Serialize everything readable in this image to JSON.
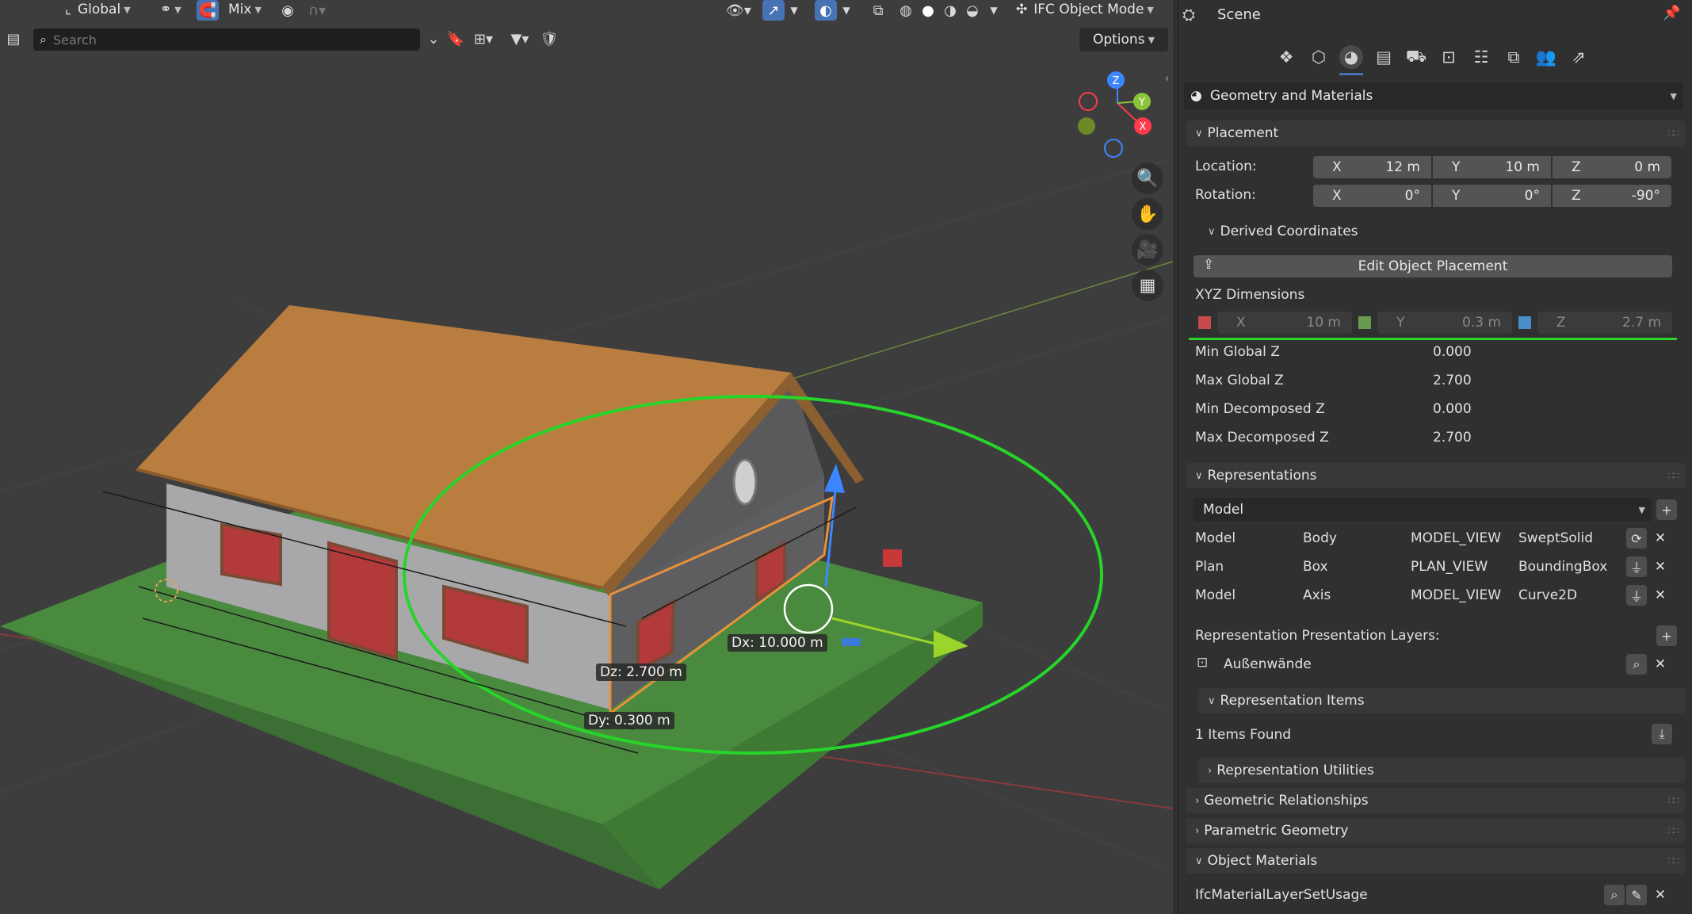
{
  "header": {
    "orientation": "Global",
    "snap_mode": "Mix",
    "mode": "IFC Object Mode",
    "search_placeholder": "Search",
    "options_label": "Options"
  },
  "viewport": {
    "gizmo_axes": [
      "Z",
      "Y",
      "X"
    ],
    "measure": {
      "dx": "Dx: 10.000 m",
      "dy": "Dy: 0.300 m",
      "dz": "Dz: 2.700 m"
    }
  },
  "panel": {
    "title": "Scene",
    "tab_icons": [
      "scene-icon",
      "object-icon",
      "geometry-materials-icon",
      "layers-icon",
      "view-icon",
      "spatial-icon",
      "properties-icon",
      "stack-icon",
      "people-icon",
      "relations-icon"
    ],
    "category": "Geometry and Materials",
    "placement": {
      "header": "Placement",
      "location_label": "Location:",
      "rotation_label": "Rotation:",
      "location": [
        {
          "axis": "X",
          "value": "12 m"
        },
        {
          "axis": "Y",
          "value": "10 m"
        },
        {
          "axis": "Z",
          "value": "0 m"
        }
      ],
      "rotation": [
        {
          "axis": "X",
          "value": "0°"
        },
        {
          "axis": "Y",
          "value": "0°"
        },
        {
          "axis": "Z",
          "value": "-90°"
        }
      ]
    },
    "derived": {
      "header": "Derived Coordinates",
      "edit_button": "Edit Object Placement",
      "dims_label": "XYZ Dimensions",
      "dims": [
        {
          "axis": "X",
          "value": "10 m",
          "color": "#c94a4a"
        },
        {
          "axis": "Y",
          "value": "0.3 m",
          "color": "#6a9a52"
        },
        {
          "axis": "Z",
          "value": "2.7 m",
          "color": "#4a8ec9"
        }
      ],
      "rows": [
        {
          "label": "Min Global Z",
          "value": "0.000"
        },
        {
          "label": "Max Global Z",
          "value": "2.700"
        },
        {
          "label": "Min Decomposed Z",
          "value": "0.000"
        },
        {
          "label": "Max Decomposed Z",
          "value": "2.700"
        }
      ]
    },
    "representations": {
      "header": "Representations",
      "context_select": "Model",
      "rows": [
        {
          "context": "Model",
          "subcontext": "Body",
          "target": "MODEL_VIEW",
          "type": "SweptSolid"
        },
        {
          "context": "Plan",
          "subcontext": "Box",
          "target": "PLAN_VIEW",
          "type": "BoundingBox"
        },
        {
          "context": "Model",
          "subcontext": "Axis",
          "target": "MODEL_VIEW",
          "type": "Curve2D"
        }
      ],
      "layers_label": "Representation Presentation Layers:",
      "layer_name": "Außenwände",
      "items_header": "Representation Items",
      "items_found": "1 Items Found",
      "utilities_header": "Representation Utilities"
    },
    "geometric_relationships": "Geometric Relationships",
    "parametric_geometry": "Parametric Geometry",
    "object_materials": "Object Materials",
    "material_usage": "IfcMaterialLayerSetUsage"
  }
}
